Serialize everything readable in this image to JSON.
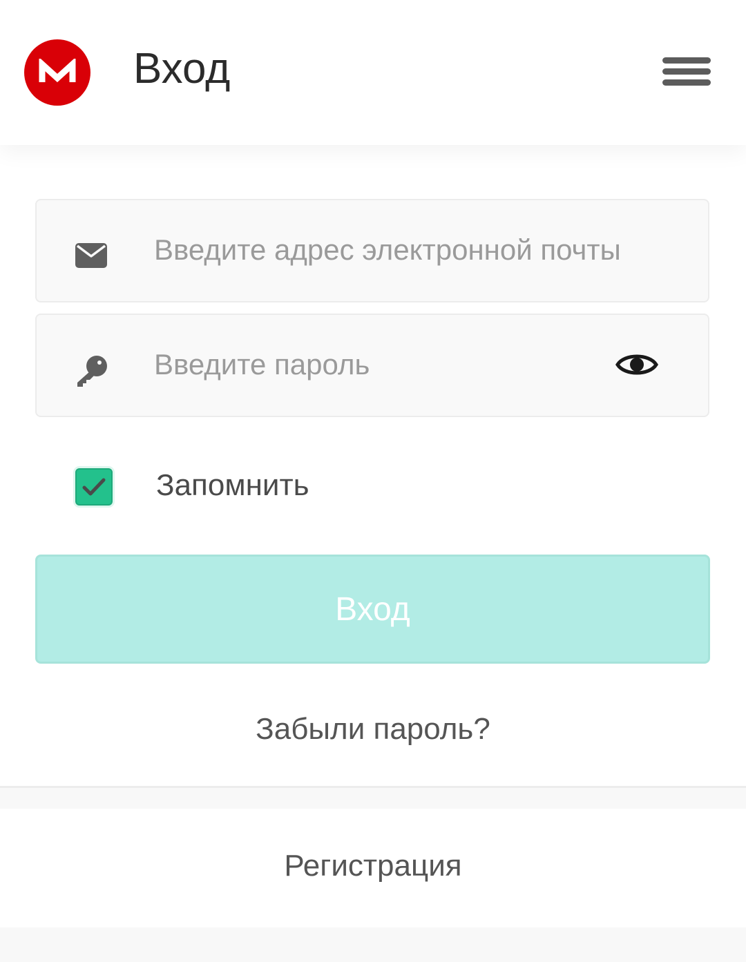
{
  "header": {
    "title": "Вход",
    "logo_letter": "M",
    "logo_color": "#d90007",
    "menu_icon": "hamburger-menu-icon"
  },
  "form": {
    "email_placeholder": "Введите адрес электронной почты",
    "email_icon": "envelope-icon",
    "password_placeholder": "Введите пароль",
    "password_icon": "key-icon",
    "show_password_icon": "eye-icon",
    "remember_label": "Запомнить",
    "remember_checked": true,
    "login_button_label": "Вход",
    "login_button_color": "#b2ece5",
    "accent_color": "#23c18c"
  },
  "links": {
    "forgot_password": "Забыли пароль?",
    "register": "Регистрация"
  }
}
